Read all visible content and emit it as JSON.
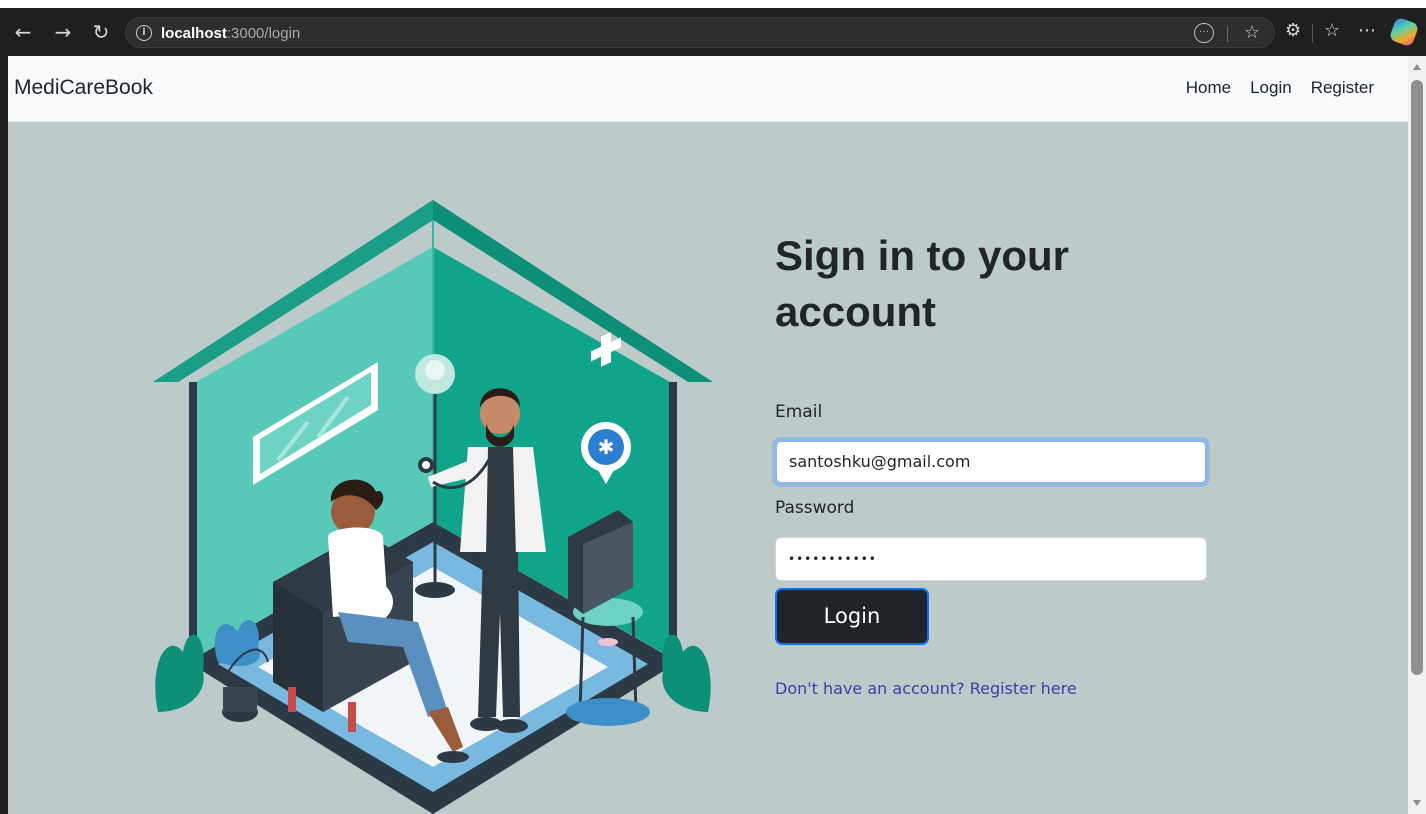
{
  "browser": {
    "url_host": "localhost",
    "url_path": ":3000/login"
  },
  "navbar": {
    "brand": "MediCareBook",
    "links": [
      "Home",
      "Login",
      "Register"
    ]
  },
  "form": {
    "heading": "Sign in to your account",
    "email_label": "Email",
    "email_value": "santoshku@gmail.com",
    "password_label": "Password",
    "password_value": "•••••••••••",
    "login_button": "Login",
    "register_link": "Don't have an account? Register here"
  },
  "colors": {
    "page_bg": "#bccbca",
    "navbar_bg": "#f8f9fa",
    "button_bg": "#212529",
    "focus_border": "#86b7fe",
    "link": "#3b3fa3",
    "teal": "#10a58a"
  }
}
